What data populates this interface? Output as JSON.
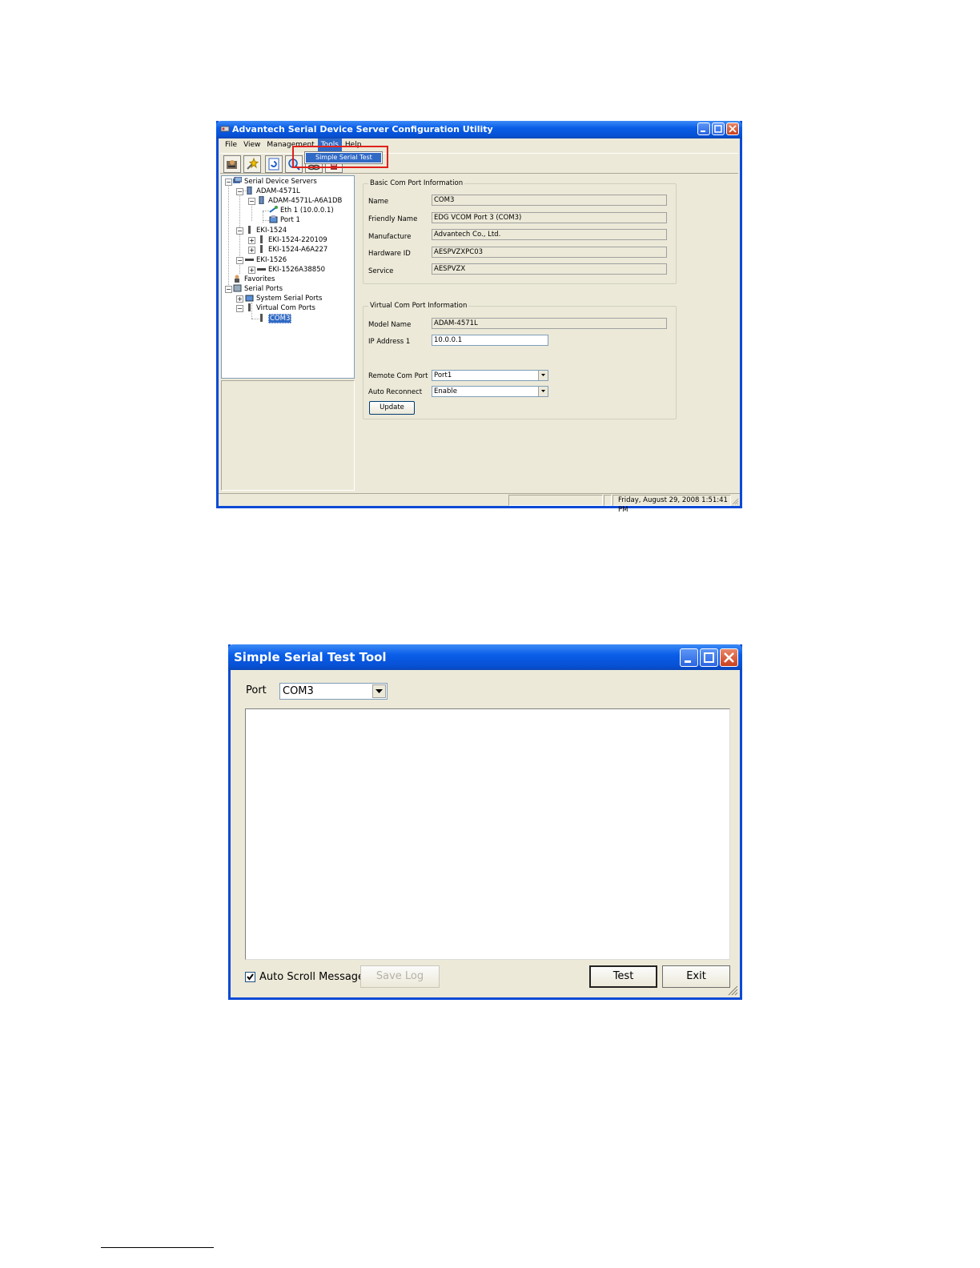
{
  "config_window": {
    "title": "Advantech Serial Device Server Configuration Utility",
    "menu": [
      "File",
      "View",
      "Management",
      "Tools",
      "Help"
    ],
    "active_menu": "Tools",
    "dropdown_item": "Simple Serial Test",
    "toolbar_icons": [
      "search-server-icon",
      "wizard-icon",
      "refresh-icon",
      "find-icon",
      "link-icon",
      "exit-icon"
    ],
    "tree": {
      "root": "Serial Device Servers",
      "adam": "ADAM-4571L",
      "adam_dev": "ADAM-4571L-A6A1DB",
      "eth": "Eth 1 (10.0.0.1)",
      "port": "Port 1",
      "eki1524": "EKI-1524",
      "eki1524_a": "EKI-1524-220109",
      "eki1524_b": "EKI-1524-A6A227",
      "eki1526": "EKI-1526",
      "eki1526_a": "EKI-1526A38850",
      "favorites": "Favorites",
      "serial_ports": "Serial Ports",
      "system_serial": "System Serial Ports",
      "virtual_com": "Virtual Com Ports",
      "com3": "COM3"
    },
    "basic": {
      "title": "Basic Com Port Information",
      "name_label": "Name",
      "name": "COM3",
      "friendly_label": "Friendly Name",
      "friendly": "EDG VCOM Port 3 (COM3)",
      "manufacture_label": "Manufacture",
      "manufacture": "Advantech Co., Ltd.",
      "hwid_label": "Hardware ID",
      "hwid": "AESPVZXPC03",
      "service_label": "Service",
      "service": "AESPVZX"
    },
    "virtual": {
      "title": "Virtual Com Port Information",
      "model_label": "Model Name",
      "model": "ADAM-4571L",
      "ip_label": "IP Address 1",
      "ip": "10.0.0.1",
      "remote_label": "Remote Com Port",
      "remote": "Port1",
      "reconnect_label": "Auto Reconnect",
      "reconnect": "Enable",
      "update": "Update"
    },
    "status": "Friday, August 29, 2008  1:51:41 PM"
  },
  "test_window": {
    "title": "Simple Serial Test Tool",
    "port_label": "Port",
    "port_value": "COM3",
    "auto_scroll": "Auto Scroll Messages",
    "auto_scroll_checked": true,
    "save_log": "Save Log",
    "test": "Test",
    "exit": "Exit"
  },
  "colors": {
    "title_blue": "#0a5ee8",
    "window_face": "#ece9d8",
    "highlight": "#316ac5",
    "annotation_red": "#e0201c"
  }
}
